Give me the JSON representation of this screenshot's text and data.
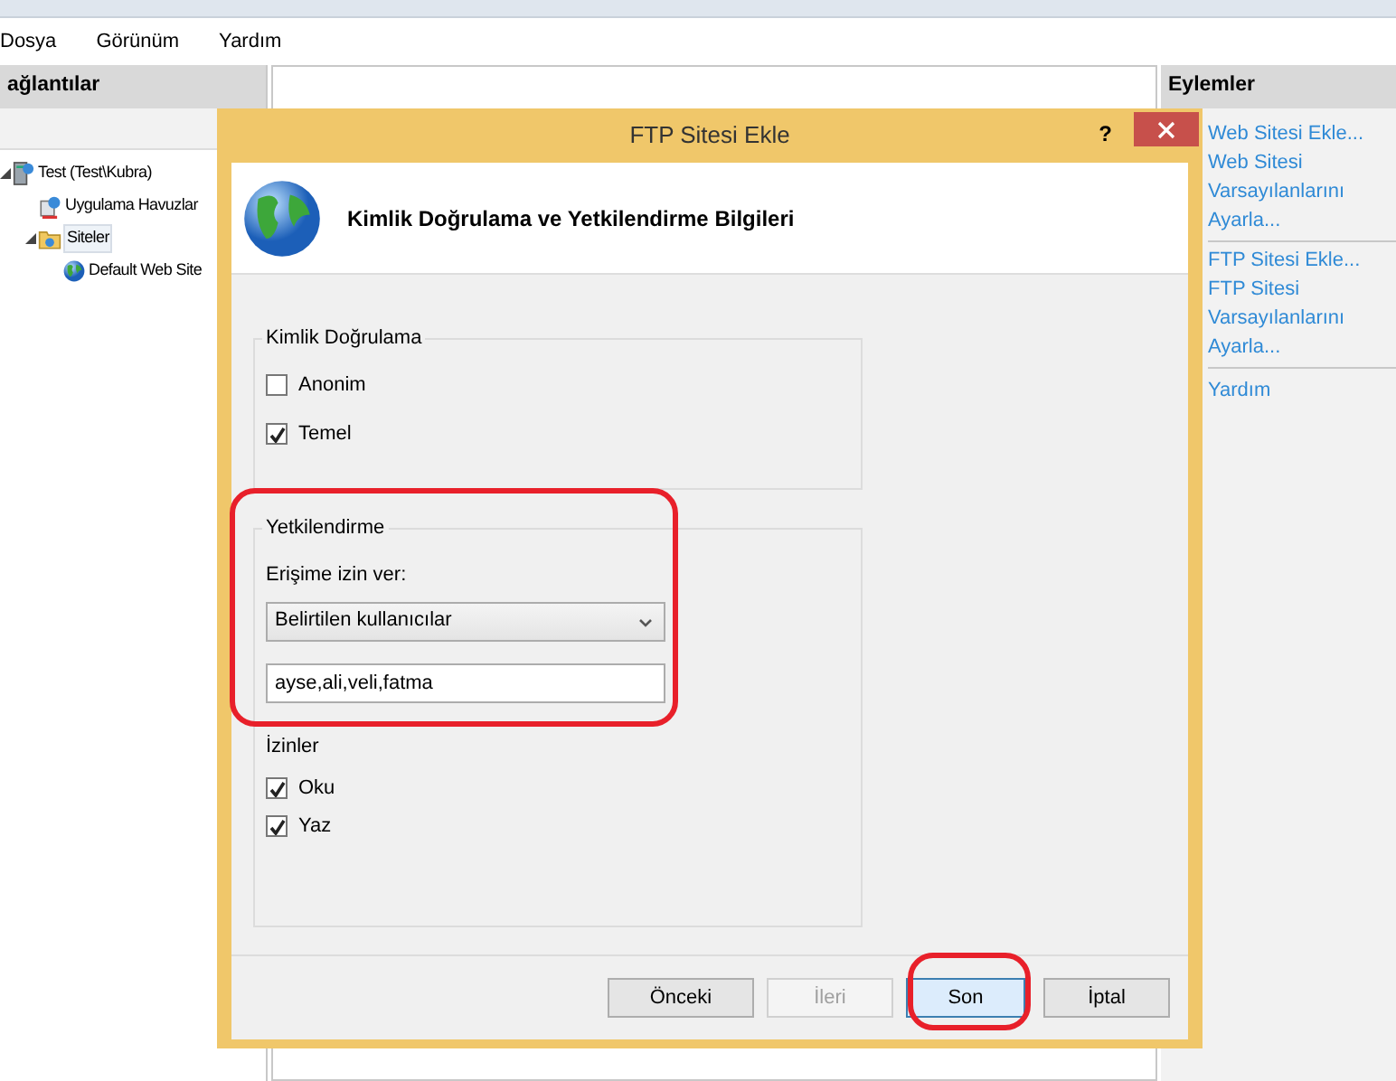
{
  "menu": [
    "Dosya",
    "Görünüm",
    "Yardım"
  ],
  "connections": {
    "title": "ağlantılar",
    "tree": [
      {
        "label": "Test (Test\\Kubra)",
        "kind": "server",
        "selected": false,
        "expanded": true,
        "children": [
          {
            "label": "Uygulama Havuzlar",
            "kind": "pool",
            "selected": false
          },
          {
            "label": "Siteler",
            "kind": "folder",
            "selected": true,
            "expanded": true,
            "children": [
              {
                "label": "Default Web Site",
                "kind": "globe",
                "selected": false
              }
            ]
          }
        ]
      }
    ]
  },
  "actions": {
    "title": "Eylemler",
    "groups": [
      [
        "Web Sitesi Ekle...",
        "Web Sitesi Varsayılanlarını Ayarla..."
      ],
      [
        "FTP Sitesi Ekle...",
        "FTP Sitesi Varsayılanlarını Ayarla..."
      ],
      [
        "Yardım"
      ]
    ]
  },
  "dialog": {
    "title": "FTP Sitesi Ekle",
    "help": "?",
    "heading": "Kimlik Doğrulama ve Yetkilendirme Bilgileri",
    "authentication": {
      "title": "Kimlik Doğrulama",
      "options": [
        {
          "label": "Anonim",
          "checked": false
        },
        {
          "label": "Temel",
          "checked": true
        }
      ]
    },
    "authorization": {
      "title": "Yetkilendirme",
      "access_label": "Erişime izin ver:",
      "access_value": "Belirtilen kullanıcılar",
      "users_value": "ayse,ali,veli,fatma",
      "permissions_title": "İzinler",
      "permissions": [
        {
          "label": "Oku",
          "checked": true
        },
        {
          "label": "Yaz",
          "checked": true
        }
      ]
    },
    "buttons": [
      {
        "label": "Önceki",
        "disabled": false,
        "default": false
      },
      {
        "label": "İleri",
        "disabled": true,
        "default": false
      },
      {
        "label": "Son",
        "disabled": false,
        "default": true
      },
      {
        "label": "İptal",
        "disabled": false,
        "default": false
      }
    ]
  }
}
